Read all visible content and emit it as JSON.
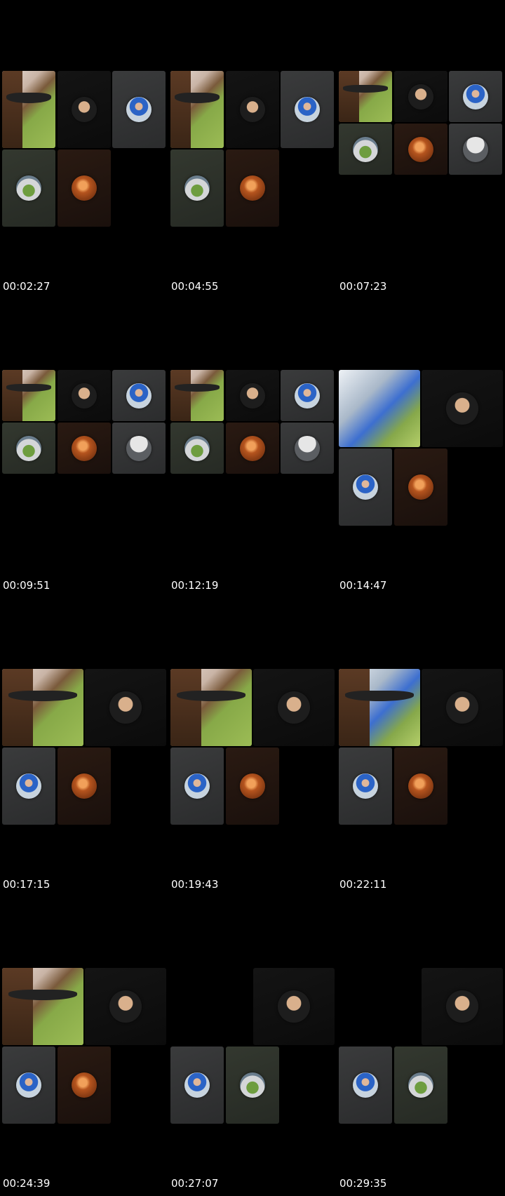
{
  "frames": [
    {
      "timestamp": "00:02:27"
    },
    {
      "timestamp": "00:04:55"
    },
    {
      "timestamp": "00:07:23"
    },
    {
      "timestamp": "00:09:51"
    },
    {
      "timestamp": "00:12:19"
    },
    {
      "timestamp": "00:14:47"
    },
    {
      "timestamp": "00:17:15"
    },
    {
      "timestamp": "00:19:43"
    },
    {
      "timestamp": "00:22:11"
    },
    {
      "timestamp": "00:24:39"
    },
    {
      "timestamp": "00:27:07"
    },
    {
      "timestamp": "00:29:35"
    }
  ],
  "icons": {
    "participant_avatar": "avatar-icon",
    "video_feed": "camera-video-feed"
  },
  "colors": {
    "background": "#000000",
    "tile_gray": "#333435",
    "tile_dark": "#111111",
    "tile_brown": "#22150f",
    "timestamp_text": "#ffffff"
  }
}
